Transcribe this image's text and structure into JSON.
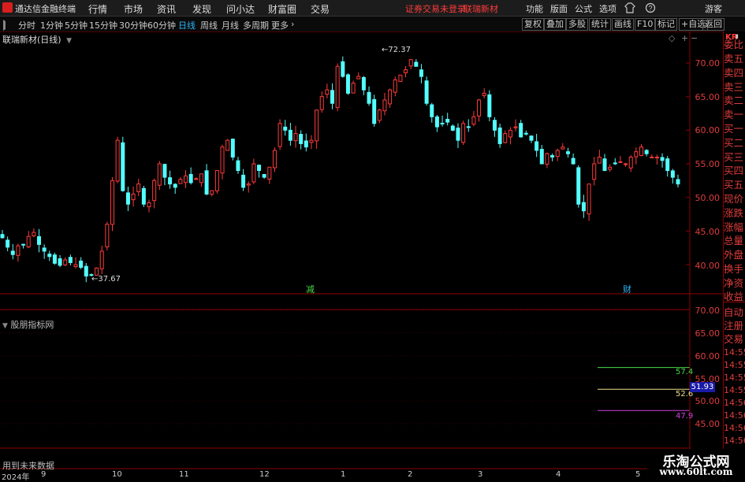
{
  "app": {
    "name": "通达信金融终端",
    "warning": "证券交易未登录",
    "stock_link": "联瑞新材",
    "guest": "游客"
  },
  "top_menu": [
    "行情",
    "市场",
    "资讯",
    "发现",
    "问小达",
    "财富圈",
    "交易"
  ],
  "right_menu": [
    "功能",
    "版面",
    "公式",
    "选项"
  ],
  "periods": [
    "分时",
    "1分钟",
    "5分钟",
    "15分钟",
    "30分钟",
    "60分钟",
    "日线",
    "周线",
    "月线",
    "多周期",
    "更多"
  ],
  "active_period": "日线",
  "toolbar_right": [
    "复权",
    "叠加",
    "多股",
    "统计",
    "画线",
    "F10",
    "标记",
    "+自选",
    "返回"
  ],
  "chart": {
    "title": "联瑞新材(日线)",
    "high_label": "72.37",
    "low_label": "37.67",
    "y_ticks": [
      "70.00",
      "65.00",
      "60.00",
      "55.00",
      "50.00",
      "45.00",
      "40.00"
    ],
    "markers": {
      "reduce": "减",
      "finance": "财"
    },
    "x_labels": [
      "2024年",
      "9",
      "10",
      "11",
      "12",
      "1",
      "2",
      "3",
      "4",
      "5"
    ],
    "colors": {
      "up": "#ff3b3b",
      "down": "#54ffff",
      "axis": "#8b0000"
    }
  },
  "indicator": {
    "title": "股朋指标网",
    "y_ticks": [
      "70.00",
      "65.00",
      "60.00",
      "55.00",
      "50.00",
      "45.00"
    ],
    "lines": [
      {
        "value": "57.4",
        "color": "#4ad94a"
      },
      {
        "value": "52.6",
        "color": "#f0e08c"
      },
      {
        "value": "47.9",
        "color": "#d040e0"
      }
    ],
    "current_value": "51.93",
    "footer_note": "用到未来数据"
  },
  "sidebar": {
    "kr_badge": "KR",
    "items": [
      "委比",
      "卖五",
      "卖四",
      "卖三",
      "卖二",
      "卖一",
      "买一",
      "买二",
      "买三",
      "买四",
      "买五",
      "现价",
      "涨跌",
      "涨幅",
      "总量",
      "外盘",
      "换手",
      "净资",
      "收益"
    ],
    "lower": [
      "自动",
      "注册",
      "交易"
    ],
    "times": [
      "14:55",
      "14:55",
      "14:55",
      "14:55",
      "14:56",
      "14:56",
      "14:56",
      "14:56"
    ]
  },
  "watermark": {
    "line1": "乐淘公式网",
    "line2": "www.60lt.com"
  },
  "chart_data": {
    "type": "candlestick",
    "title": "联瑞新材(日线)",
    "ylim": [
      37,
      74
    ],
    "close": [
      44.0,
      42.6,
      41.5,
      42.8,
      43.0,
      44.2,
      44.8,
      43.0,
      42.0,
      41.2,
      40.2,
      39.9,
      40.7,
      40.3,
      40.0,
      39.6,
      38.3,
      38.5,
      39.5,
      42.0,
      46.0,
      52.5,
      58.5,
      51.0,
      49.0,
      50.5,
      52.0,
      49.0,
      49.2,
      52.5,
      55.0,
      53.0,
      52.0,
      51.5,
      52.7,
      53.2,
      52.2,
      52.8,
      53.5,
      50.5,
      51.0,
      54.0,
      57.5,
      58.5,
      56.0,
      54.0,
      51.5,
      52.0,
      55.0,
      54.0,
      53.0,
      54.5,
      57.0,
      61.0,
      60.0,
      58.5,
      59.5,
      58.0,
      57.5,
      58.5,
      63.0,
      65.0,
      66.0,
      64.0,
      69.5,
      68.0,
      65.5,
      67.0,
      68.0,
      66.0,
      64.0,
      61.0,
      63.0,
      64.5,
      66.0,
      67.5,
      68.2,
      69.0,
      70.5,
      69.5,
      68.0,
      64.0,
      62.0,
      60.5,
      61.0,
      61.2,
      60.0,
      58.5,
      61.0,
      60.5,
      62.0,
      64.5,
      65.5,
      62.0,
      60.0,
      58.0,
      59.5,
      60.0,
      60.5,
      59.0,
      59.5,
      58.5,
      57.0,
      55.0,
      56.5,
      56.0,
      57.0,
      57.5,
      56.5,
      55.0,
      49.0,
      48.0,
      52.0,
      55.0,
      56.0,
      54.0,
      54.5,
      55.0,
      55.3,
      55.0,
      56.0,
      56.8,
      57.5,
      56.5,
      56.0,
      56.0,
      55.5,
      54.0,
      53.0,
      52.0
    ],
    "high_label": 72.37,
    "low_label": 37.67,
    "indicator": {
      "title": "股朋指标网",
      "levels": [
        57.4,
        52.6,
        47.9
      ],
      "current": 51.93
    }
  }
}
